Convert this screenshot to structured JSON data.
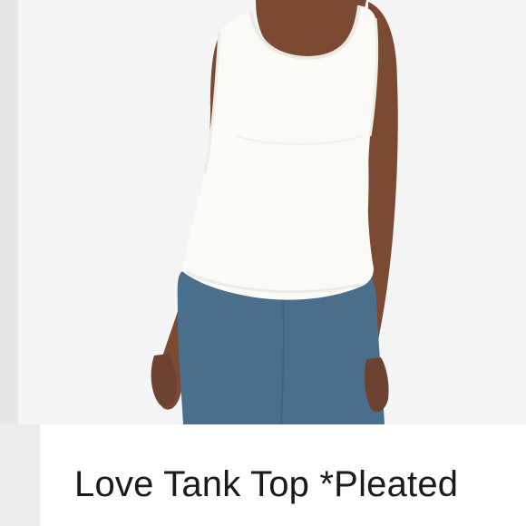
{
  "listing": {
    "title": "Love Tank Top *Pleated"
  },
  "photo": {
    "subject": "product-photo"
  },
  "colors": {
    "background": "#f5f5f5",
    "tank": "#fbfaf7",
    "pants": "#4a6f8d",
    "skin": "#7a4a33",
    "text": "#1a1a1a"
  }
}
